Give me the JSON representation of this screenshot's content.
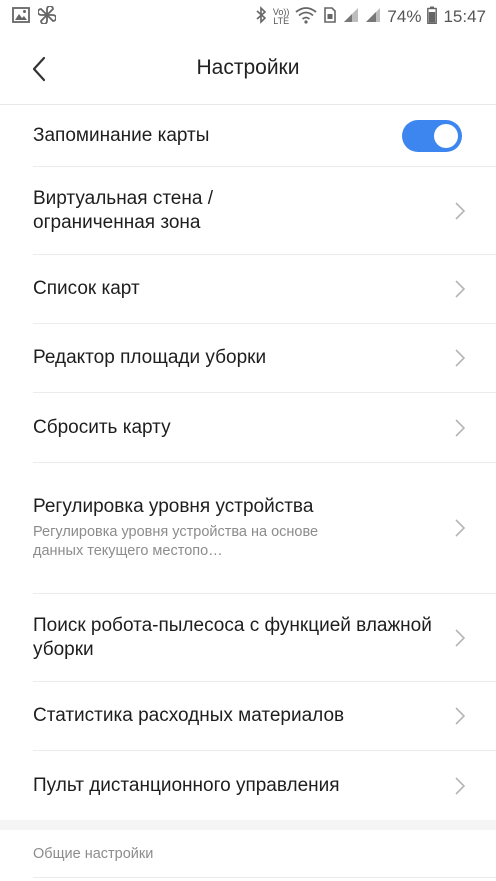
{
  "status_bar": {
    "battery": "74%",
    "time": "15:47",
    "volte_top": "Vo))",
    "volte_bottom": "LTE",
    "icons": [
      "image-icon",
      "pinwheel-icon",
      "bluetooth-icon",
      "wifi-icon",
      "sim-icon",
      "signal-icon",
      "battery-icon"
    ]
  },
  "header": {
    "title": "Настройки",
    "back_icon": "chevron-left-icon"
  },
  "settings": [
    {
      "title": "Запоминание карты",
      "control": "toggle",
      "enabled": true
    },
    {
      "title": "Виртуальная стена / ограниченная зона",
      "control": "chevron"
    },
    {
      "title": "Список карт",
      "control": "chevron"
    },
    {
      "title": "Редактор площади уборки",
      "control": "chevron"
    },
    {
      "title": "Сбросить карту",
      "control": "chevron"
    },
    {
      "title": "Регулировка уровня устройства",
      "subtitle": "Регулировка уровня устройства на основе данных текущего местопо…",
      "control": "chevron"
    },
    {
      "title": "Поиск робота-пылесоса с функцией влажной уборки",
      "control": "chevron"
    },
    {
      "title": "Статистика расходных материалов",
      "control": "chevron"
    },
    {
      "title": "Пульт дистанционного управления",
      "control": "chevron"
    }
  ],
  "general_section": {
    "label": "Общие настройки"
  },
  "colors": {
    "accent": "#3d86f0",
    "divider": "#ececec",
    "subtitle": "#8c8c8c"
  }
}
